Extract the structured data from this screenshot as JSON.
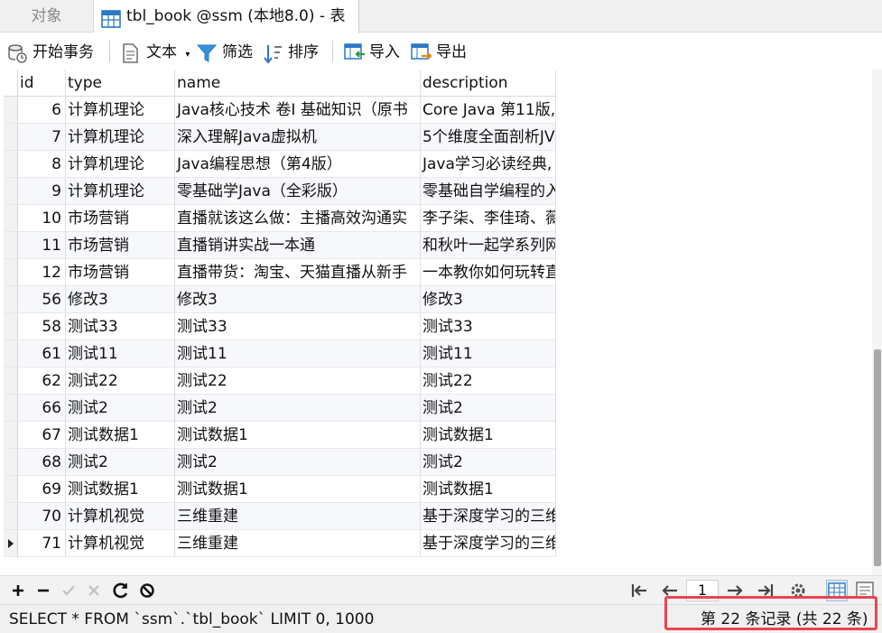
{
  "tabs": {
    "objects_label": "对象",
    "table_label": "tbl_book @ssm (本地8.0) - 表"
  },
  "toolbar": {
    "begin_transaction": "开始事务",
    "text": "文本",
    "filter": "筛选",
    "sort": "排序",
    "import": "导入",
    "export": "导出"
  },
  "columns": [
    "id",
    "type",
    "name",
    "description"
  ],
  "rows": [
    {
      "id": "6",
      "type": "计算机理论",
      "name": "Java核心技术 卷I 基础知识（原书",
      "description": "Core Java 第11版,"
    },
    {
      "id": "7",
      "type": "计算机理论",
      "name": "深入理解Java虚拟机",
      "description": "5个维度全面剖析JV"
    },
    {
      "id": "8",
      "type": "计算机理论",
      "name": "Java编程思想（第4版）",
      "description": "Java学习必读经典,"
    },
    {
      "id": "9",
      "type": "计算机理论",
      "name": "零基础学Java（全彩版）",
      "description": "零基础自学编程的入"
    },
    {
      "id": "10",
      "type": "市场营销",
      "name": "直播就该这么做：主播高效沟通实",
      "description": "李子柒、李佳琦、薇"
    },
    {
      "id": "11",
      "type": "市场营销",
      "name": "直播销讲实战一本通",
      "description": "和秋叶一起学系列网"
    },
    {
      "id": "12",
      "type": "市场营销",
      "name": "直播带货：淘宝、天猫直播从新手",
      "description": "一本教你如何玩转直"
    },
    {
      "id": "56",
      "type": "修改3",
      "name": "修改3",
      "description": "修改3"
    },
    {
      "id": "58",
      "type": "测试33",
      "name": "测试33",
      "description": "测试33"
    },
    {
      "id": "61",
      "type": "测试11",
      "name": "测试11",
      "description": "测试11"
    },
    {
      "id": "62",
      "type": "测试22",
      "name": "测试22",
      "description": "测试22"
    },
    {
      "id": "66",
      "type": "测试2",
      "name": "测试2",
      "description": "测试2"
    },
    {
      "id": "67",
      "type": "测试数据1",
      "name": "测试数据1",
      "description": "测试数据1"
    },
    {
      "id": "68",
      "type": "测试2",
      "name": "测试2",
      "description": "测试2"
    },
    {
      "id": "69",
      "type": "测试数据1",
      "name": "测试数据1",
      "description": "测试数据1"
    },
    {
      "id": "70",
      "type": "计算机视觉",
      "name": "三维重建",
      "description": "基于深度学习的三维"
    },
    {
      "id": "71",
      "type": "计算机视觉",
      "name": "三维重建",
      "description": "基于深度学习的三维"
    }
  ],
  "selected_row_id": "71",
  "navigation": {
    "page": "1"
  },
  "status": {
    "sql": "SELECT * FROM `ssm`.`tbl_book` LIMIT 0, 1000",
    "records": "第 22 条记录 (共 22 条)"
  },
  "colors": {
    "highlight": "#e8454f",
    "accent": "#2b78c5"
  },
  "icons": [
    "table-icon",
    "transaction-icon",
    "text-icon",
    "filter-icon",
    "sort-icon",
    "import-icon",
    "export-icon",
    "add-icon",
    "remove-icon",
    "apply-icon",
    "discard-icon",
    "refresh-icon",
    "stop-icon",
    "first-page-icon",
    "prev-page-icon",
    "next-page-icon",
    "last-page-icon",
    "settings-icon",
    "grid-view-icon",
    "form-view-icon"
  ]
}
